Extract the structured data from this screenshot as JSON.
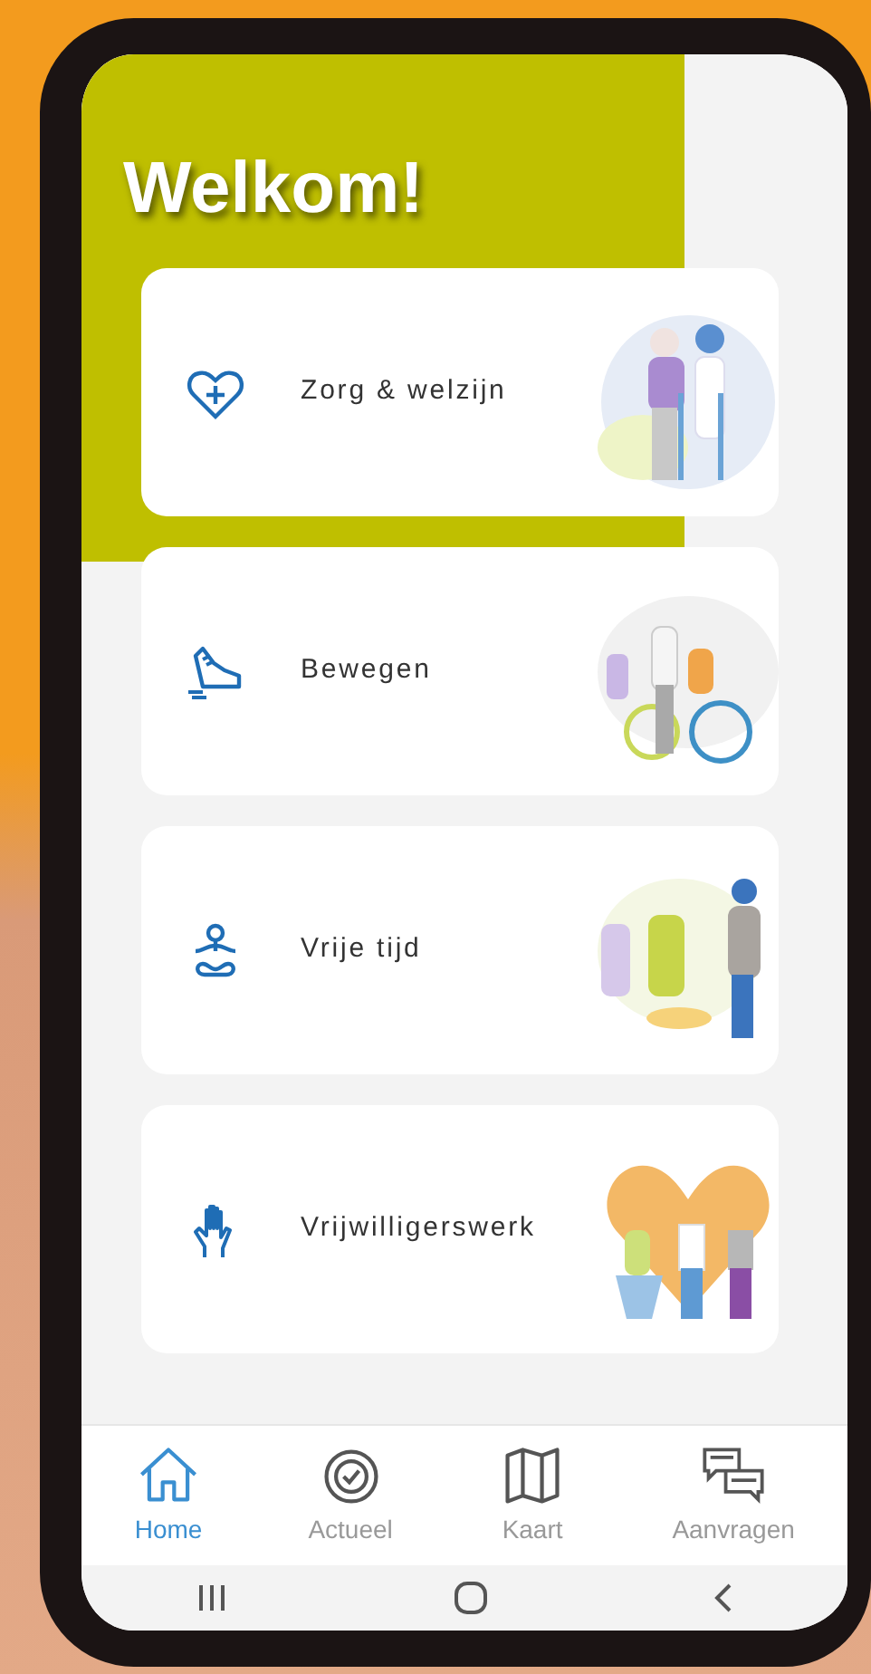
{
  "title": "Welkom!",
  "cards": [
    {
      "label": "Zorg & welzijn"
    },
    {
      "label": "Bewegen"
    },
    {
      "label": "Vrije tijd"
    },
    {
      "label": "Vrijwilligerswerk"
    }
  ],
  "tabs": [
    {
      "label": "Home",
      "selected": true
    },
    {
      "label": "Actueel",
      "selected": false
    },
    {
      "label": "Kaart",
      "selected": false
    },
    {
      "label": "Aanvragen",
      "selected": false
    }
  ]
}
